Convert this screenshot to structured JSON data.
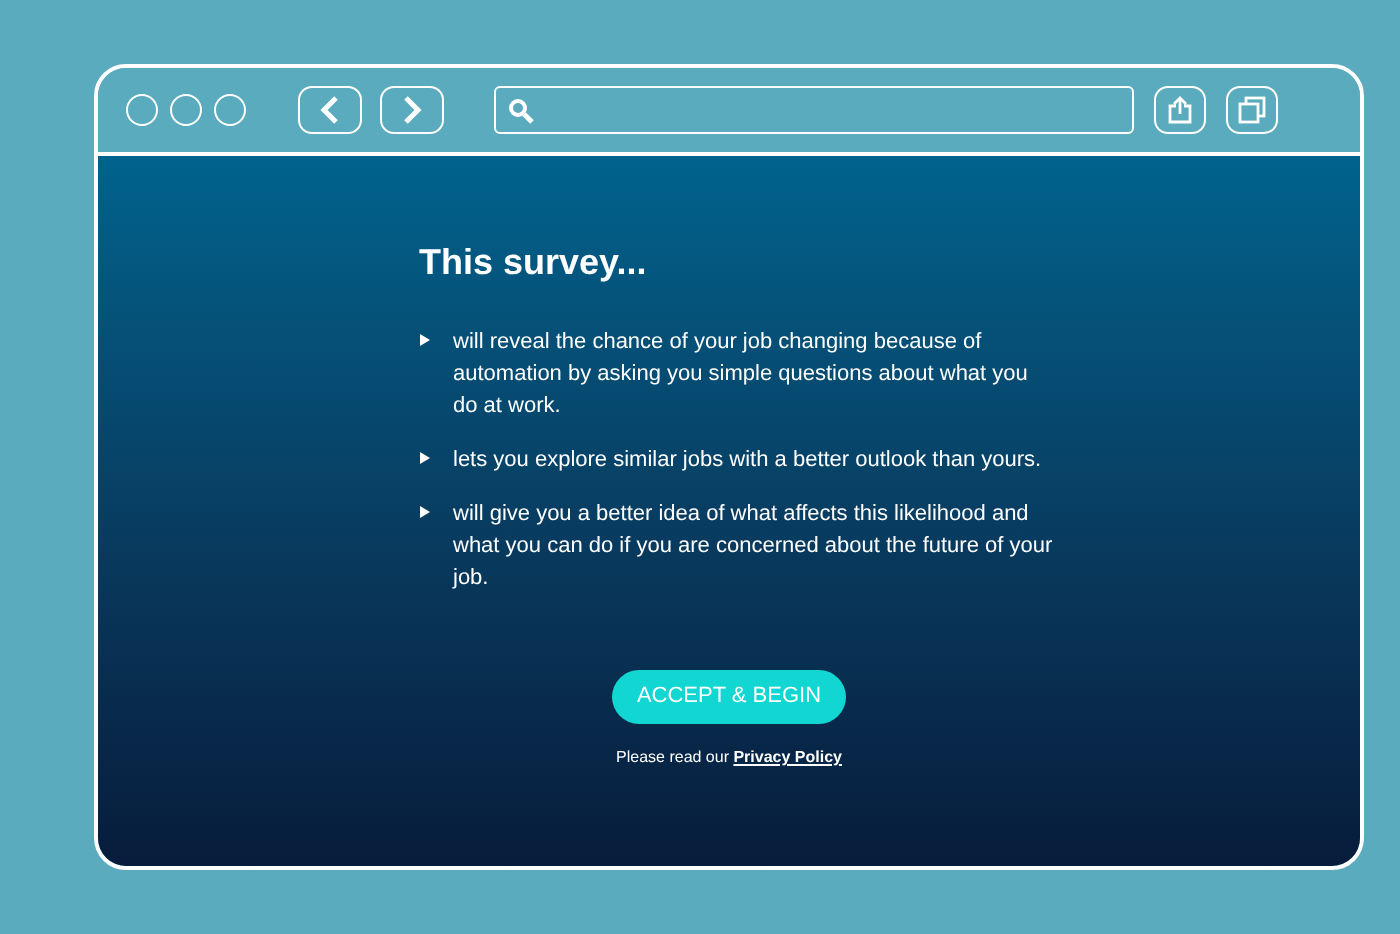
{
  "survey": {
    "title": "This survey...",
    "points": [
      "will reveal the chance of your job changing because of automation by asking you simple questions about what you do at work.",
      "lets you explore similar jobs with a better outlook than yours.",
      "will give you a better idea of what affects this likelihood and what you can do if you are concerned about the future of your job."
    ],
    "button": "ACCEPT & BEGIN",
    "privacy_prefix": "Please read our",
    "privacy_link": "Privacy Policy"
  }
}
